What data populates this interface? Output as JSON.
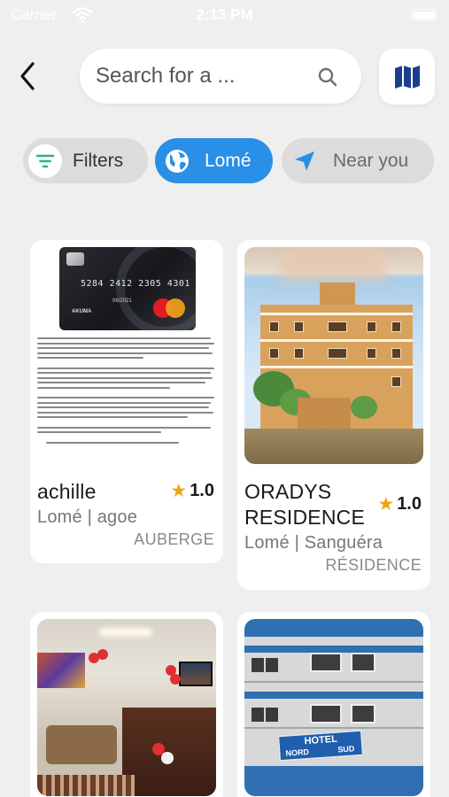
{
  "status_bar": {
    "carrier": "Carrier",
    "time": "2:13 PM"
  },
  "header": {
    "back_icon": "chevron-left-icon",
    "search": {
      "placeholder": "Search for a ...",
      "value": "",
      "icon": "search-icon"
    },
    "map_icon": "map-icon"
  },
  "chips": [
    {
      "label": "Filters",
      "icon": "filter-icon",
      "active": false
    },
    {
      "label": "Lomé",
      "icon": "globe-icon",
      "active": true
    },
    {
      "label": "Near you",
      "icon": "location-arrow-icon",
      "active": false
    }
  ],
  "listings": [
    {
      "title": "achille",
      "rating": "1.0",
      "location": "Lomé | agoe",
      "type": "AUBERGE",
      "card_image": {
        "number": "5284  2412  2305  4301",
        "valid": "06/2021",
        "holder": "AKUMA"
      }
    },
    {
      "title": "ORADYS RESIDENCE",
      "rating": "1.0",
      "location": "Lomé | Sanguéra",
      "type": "RÉSIDENCE"
    },
    {
      "title": "",
      "rating": "",
      "location": "",
      "type": ""
    },
    {
      "title": "",
      "rating": "",
      "location": "",
      "type": "",
      "card_image": {
        "sign_line1": "HOTEL",
        "sign_line2": "NORD",
        "sign_line3": "SUD"
      }
    }
  ],
  "colors": {
    "background": "#efefef",
    "accent": "#2a8fe6",
    "map_icon": "#1a3f8f",
    "filter_icon": "#2bb673",
    "star": "#f2a21a"
  }
}
